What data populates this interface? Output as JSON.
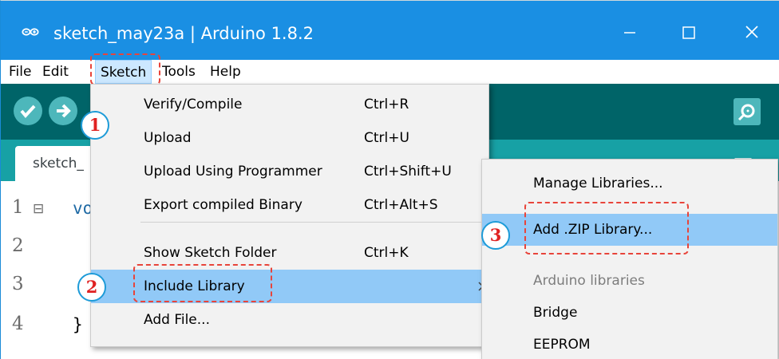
{
  "window": {
    "title": "sketch_may23a | Arduino 1.8.2",
    "controls": {
      "minimize": "─",
      "maximize": "☐",
      "close": "✕"
    }
  },
  "menubar": {
    "items": [
      "File",
      "Edit",
      "Sketch",
      "Tools",
      "Help"
    ]
  },
  "editor": {
    "tab_label": "sketch_",
    "lines": [
      {
        "number": "1",
        "fold": "⊟",
        "code": "vo"
      },
      {
        "number": "2",
        "fold": "",
        "code": ""
      },
      {
        "number": "3",
        "fold": "",
        "code": ""
      },
      {
        "number": "4",
        "fold": "",
        "code": "}"
      }
    ]
  },
  "sketch_menu": {
    "items": [
      {
        "label": "Verify/Compile",
        "shortcut": "Ctrl+R"
      },
      {
        "label": "Upload",
        "shortcut": "Ctrl+U"
      },
      {
        "label": "Upload Using Programmer",
        "shortcut": "Ctrl+Shift+U"
      },
      {
        "label": "Export compiled Binary",
        "shortcut": "Ctrl+Alt+S"
      },
      {
        "label": "Show Sketch Folder",
        "shortcut": "Ctrl+K"
      },
      {
        "label": "Include Library",
        "shortcut": ""
      },
      {
        "label": "Add File...",
        "shortcut": ""
      }
    ]
  },
  "library_menu": {
    "items": [
      {
        "label": "Manage Libraries..."
      },
      {
        "label": "Add .ZIP Library..."
      },
      {
        "label": "Arduino libraries"
      },
      {
        "label": "Bridge"
      },
      {
        "label": "EEPROM"
      }
    ]
  },
  "steps": {
    "one": "1",
    "two": "2",
    "three": "3"
  },
  "colors": {
    "titlebar": "#1a8fe3",
    "toolbar": "#006468",
    "tabbar": "#17a1a5",
    "highlight": "#91c9f7",
    "marker": "#e8443a",
    "badge_ring": "#1d9bd8"
  },
  "icons": [
    "arduino-logo-icon",
    "checkmark-icon",
    "arrow-right-icon",
    "magnifier-icon",
    "dropdown-triangle-icon",
    "submenu-arrow-icon",
    "scroll-up-arrow-icon"
  ]
}
